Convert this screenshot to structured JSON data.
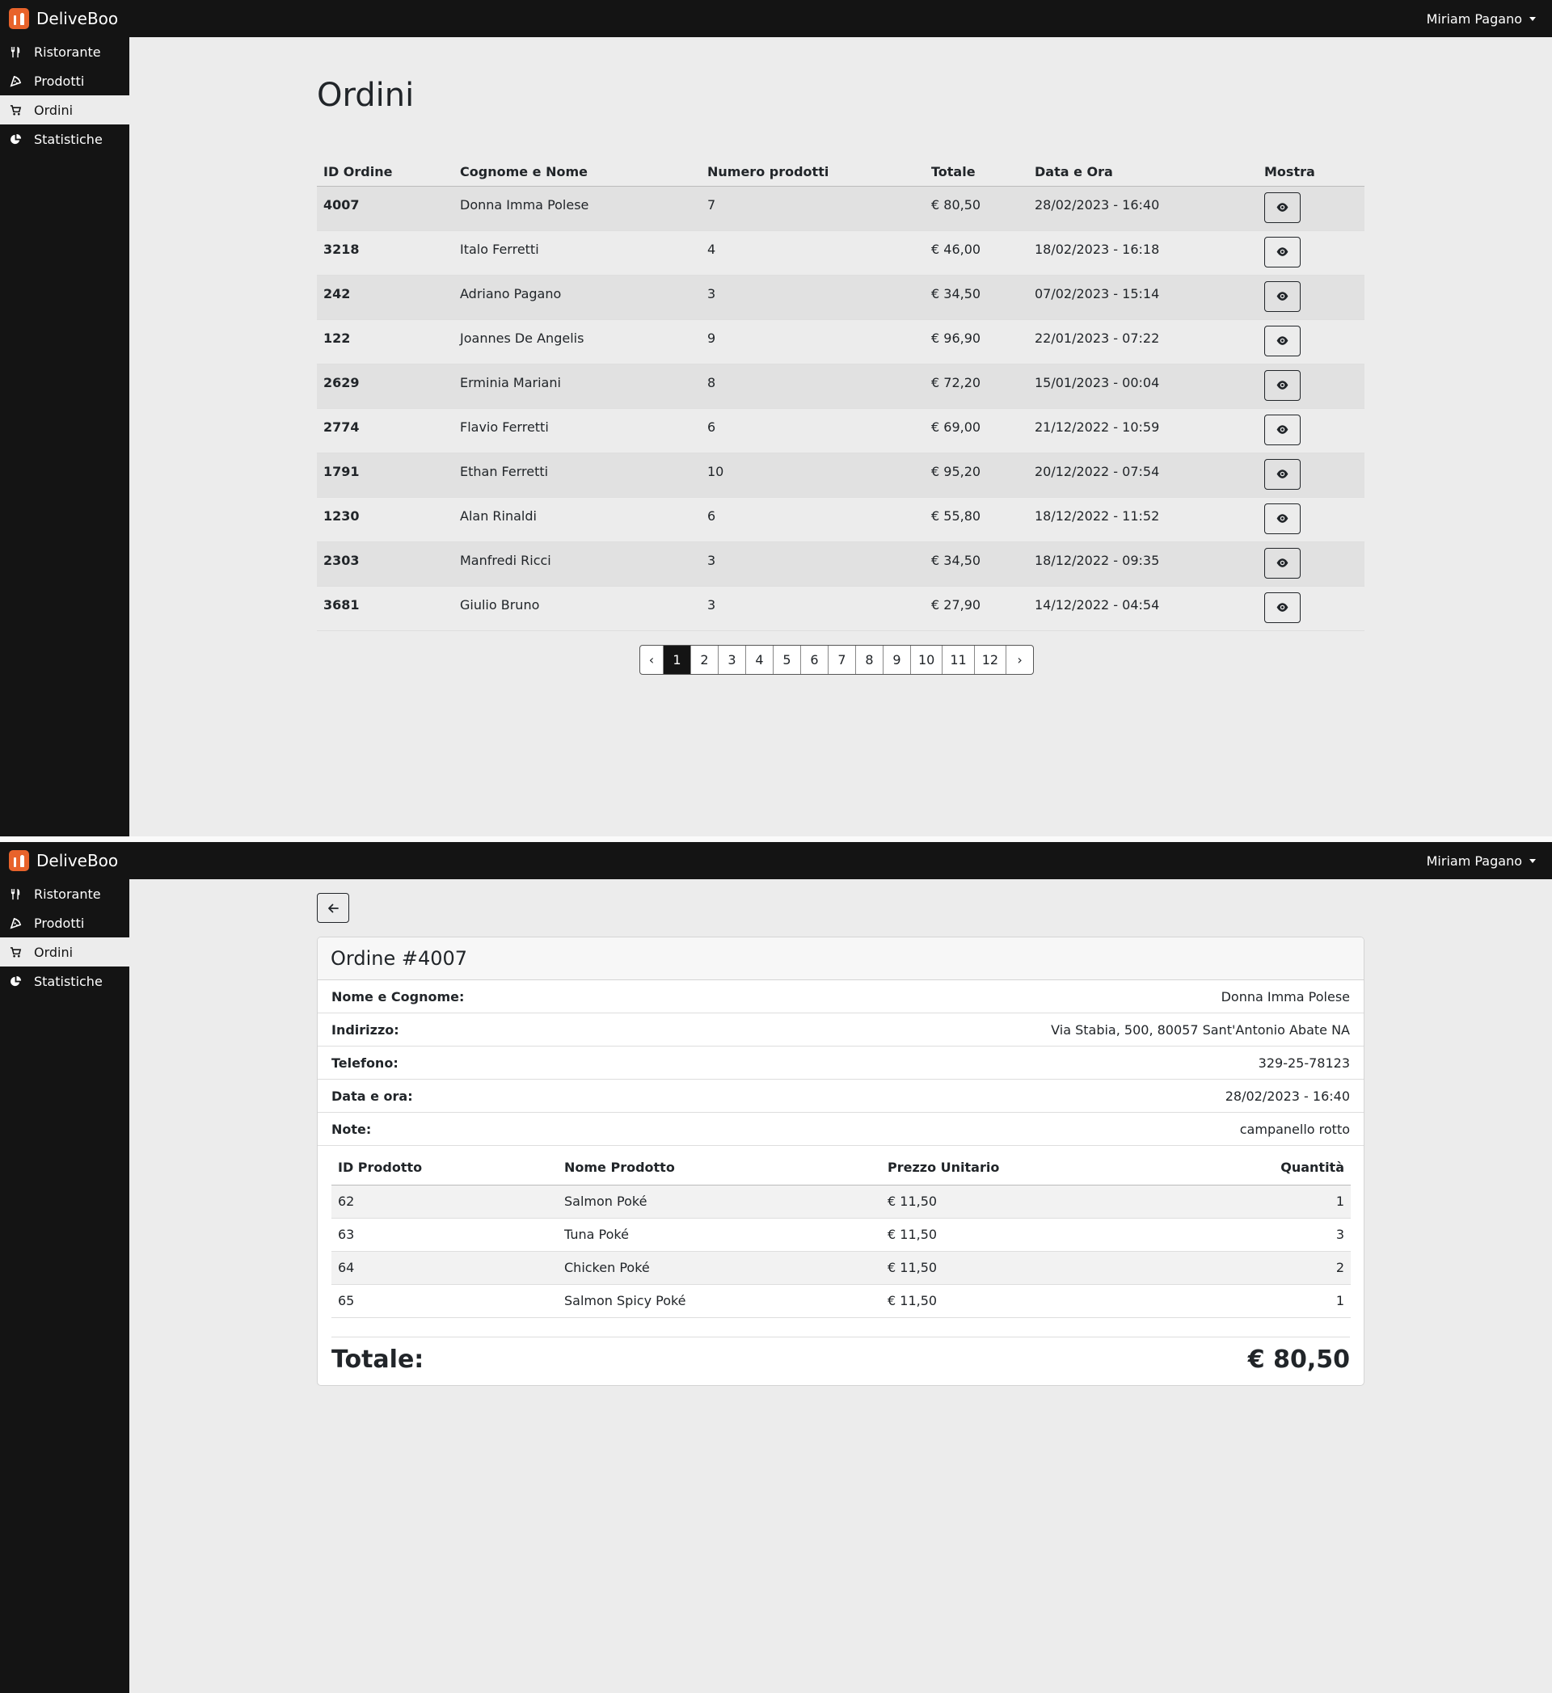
{
  "app": {
    "brand": "DeliveBoo",
    "user_name": "Miriam Pagano"
  },
  "sidebar": {
    "items": [
      {
        "label": "Ristorante",
        "icon": "utensils-icon"
      },
      {
        "label": "Prodotti",
        "icon": "pizza-slice-icon"
      },
      {
        "label": "Ordini",
        "icon": "cart-icon",
        "active": true
      },
      {
        "label": "Statistiche",
        "icon": "pie-chart-icon"
      }
    ]
  },
  "orders_page": {
    "title": "Ordini",
    "columns": [
      "ID Ordine",
      "Cognome e Nome",
      "Numero prodotti",
      "Totale",
      "Data e Ora",
      "Mostra"
    ],
    "rows": [
      {
        "id": "4007",
        "name": "Donna Imma Polese",
        "count": "7",
        "total": "€ 80,50",
        "datetime": "28/02/2023 - 16:40"
      },
      {
        "id": "3218",
        "name": "Italo Ferretti",
        "count": "4",
        "total": "€ 46,00",
        "datetime": "18/02/2023 - 16:18"
      },
      {
        "id": "242",
        "name": "Adriano Pagano",
        "count": "3",
        "total": "€ 34,50",
        "datetime": "07/02/2023 - 15:14"
      },
      {
        "id": "122",
        "name": "Joannes De Angelis",
        "count": "9",
        "total": "€ 96,90",
        "datetime": "22/01/2023 - 07:22"
      },
      {
        "id": "2629",
        "name": "Erminia Mariani",
        "count": "8",
        "total": "€ 72,20",
        "datetime": "15/01/2023 - 00:04"
      },
      {
        "id": "2774",
        "name": "Flavio Ferretti",
        "count": "6",
        "total": "€ 69,00",
        "datetime": "21/12/2022 - 10:59"
      },
      {
        "id": "1791",
        "name": "Ethan Ferretti",
        "count": "10",
        "total": "€ 95,20",
        "datetime": "20/12/2022 - 07:54"
      },
      {
        "id": "1230",
        "name": "Alan Rinaldi",
        "count": "6",
        "total": "€ 55,80",
        "datetime": "18/12/2022 - 11:52"
      },
      {
        "id": "2303",
        "name": "Manfredi Ricci",
        "count": "3",
        "total": "€ 34,50",
        "datetime": "18/12/2022 - 09:35"
      },
      {
        "id": "3681",
        "name": "Giulio Bruno",
        "count": "3",
        "total": "€ 27,90",
        "datetime": "14/12/2022 - 04:54"
      }
    ],
    "pagination": {
      "prev": "‹",
      "pages": [
        "1",
        "2",
        "3",
        "4",
        "5",
        "6",
        "7",
        "8",
        "9",
        "10",
        "11",
        "12"
      ],
      "current": "1",
      "next": "›"
    }
  },
  "order_detail": {
    "title": "Ordine #4007",
    "info": [
      {
        "label": "Nome e Cognome:",
        "value": "Donna Imma Polese"
      },
      {
        "label": "Indirizzo:",
        "value": "Via Stabia, 500, 80057 Sant'Antonio Abate NA"
      },
      {
        "label": "Telefono:",
        "value": "329-25-78123"
      },
      {
        "label": "Data e ora:",
        "value": "28/02/2023 - 16:40"
      },
      {
        "label": "Note:",
        "value": "campanello rotto"
      }
    ],
    "product_columns": [
      "ID Prodotto",
      "Nome Prodotto",
      "Prezzo Unitario",
      "Quantità"
    ],
    "products": [
      {
        "id": "62",
        "name": "Salmon Poké",
        "price": "€ 11,50",
        "qty": "1"
      },
      {
        "id": "63",
        "name": "Tuna Poké",
        "price": "€ 11,50",
        "qty": "3"
      },
      {
        "id": "64",
        "name": "Chicken Poké",
        "price": "€ 11,50",
        "qty": "2"
      },
      {
        "id": "65",
        "name": "Salmon Spicy Poké",
        "price": "€ 11,50",
        "qty": "1"
      }
    ],
    "total_label": "Totale:",
    "total_value": "€ 80,50"
  },
  "colors": {
    "navbar": "#141414",
    "background": "#ececec",
    "brand_accent": "#e8632b"
  }
}
